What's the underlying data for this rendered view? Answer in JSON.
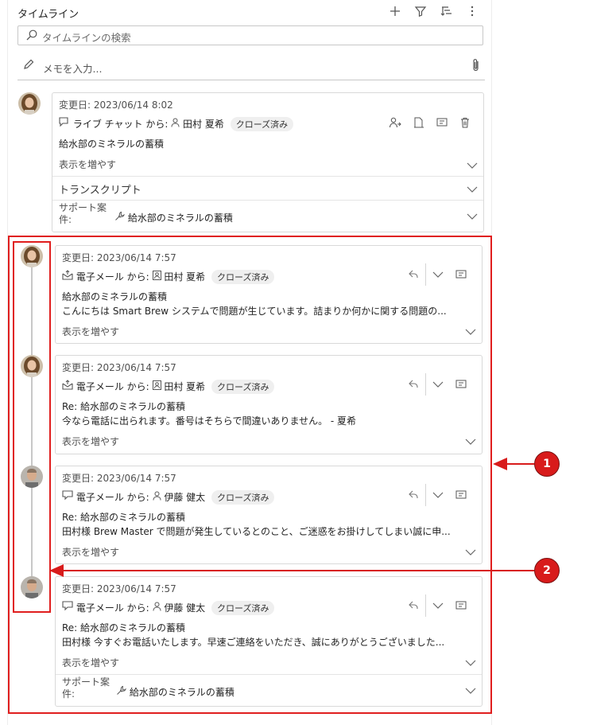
{
  "header": {
    "title": "タイムライン"
  },
  "search": {
    "placeholder": "タイムラインの検索"
  },
  "note": {
    "placeholder": "メモを入力..."
  },
  "cards": [
    {
      "modified": "変更日: 2023/06/14 8:02",
      "from_label": "ライブ チャット から:",
      "from_name": "田村 夏希",
      "status": "クローズ済み",
      "line1": "給水部のミネラルの蓄積",
      "line2": "",
      "more": "表示を増やす",
      "transcript": "トランスクリプト",
      "case_label": "サポート案件:",
      "case_value": "給水部のミネラルの蓄積"
    },
    {
      "modified": "変更日: 2023/06/14 7:57",
      "from_label": "電子メール から:",
      "from_name": "田村 夏希",
      "status": "クローズ済み",
      "line1": "給水部のミネラルの蓄積",
      "line2": "こんにちは Smart Brew システムで問題が生じています。詰まりか何かに関する問題の...",
      "more": "表示を増やす"
    },
    {
      "modified": "変更日: 2023/06/14 7:57",
      "from_label": "電子メール から:",
      "from_name": "田村 夏希",
      "status": "クローズ済み",
      "line1": "Re: 給水部のミネラルの蓄積",
      "line2": "今なら電話に出られます。番号はそちらで間違いありません。 - 夏希",
      "more": "表示を増やす"
    },
    {
      "modified": "変更日: 2023/06/14 7:57",
      "from_label": "電子メール から:",
      "from_name": "伊藤 健太",
      "status": "クローズ済み",
      "line1": "Re: 給水部のミネラルの蓄積",
      "line2": "田村様 Brew Master で問題が発生しているとのこと、ご迷惑をお掛けしてしまい誠に申...",
      "more": "表示を増やす"
    },
    {
      "modified": "変更日: 2023/06/14 7:57",
      "from_label": "電子メール から:",
      "from_name": "伊藤 健太",
      "status": "クローズ済み",
      "line1": "Re: 給水部のミネラルの蓄積",
      "line2": "田村様 今すぐお電話いたします。早速ご連絡をいただき、誠にありがとうございました...",
      "more": "表示を増やす",
      "case_label": "サポート案件:",
      "case_value": "給水部のミネラルの蓄積"
    }
  ],
  "callouts": [
    "1",
    "2"
  ],
  "colors": {
    "callout_red": "#d81b1b",
    "box_red": "#e01e1e"
  }
}
